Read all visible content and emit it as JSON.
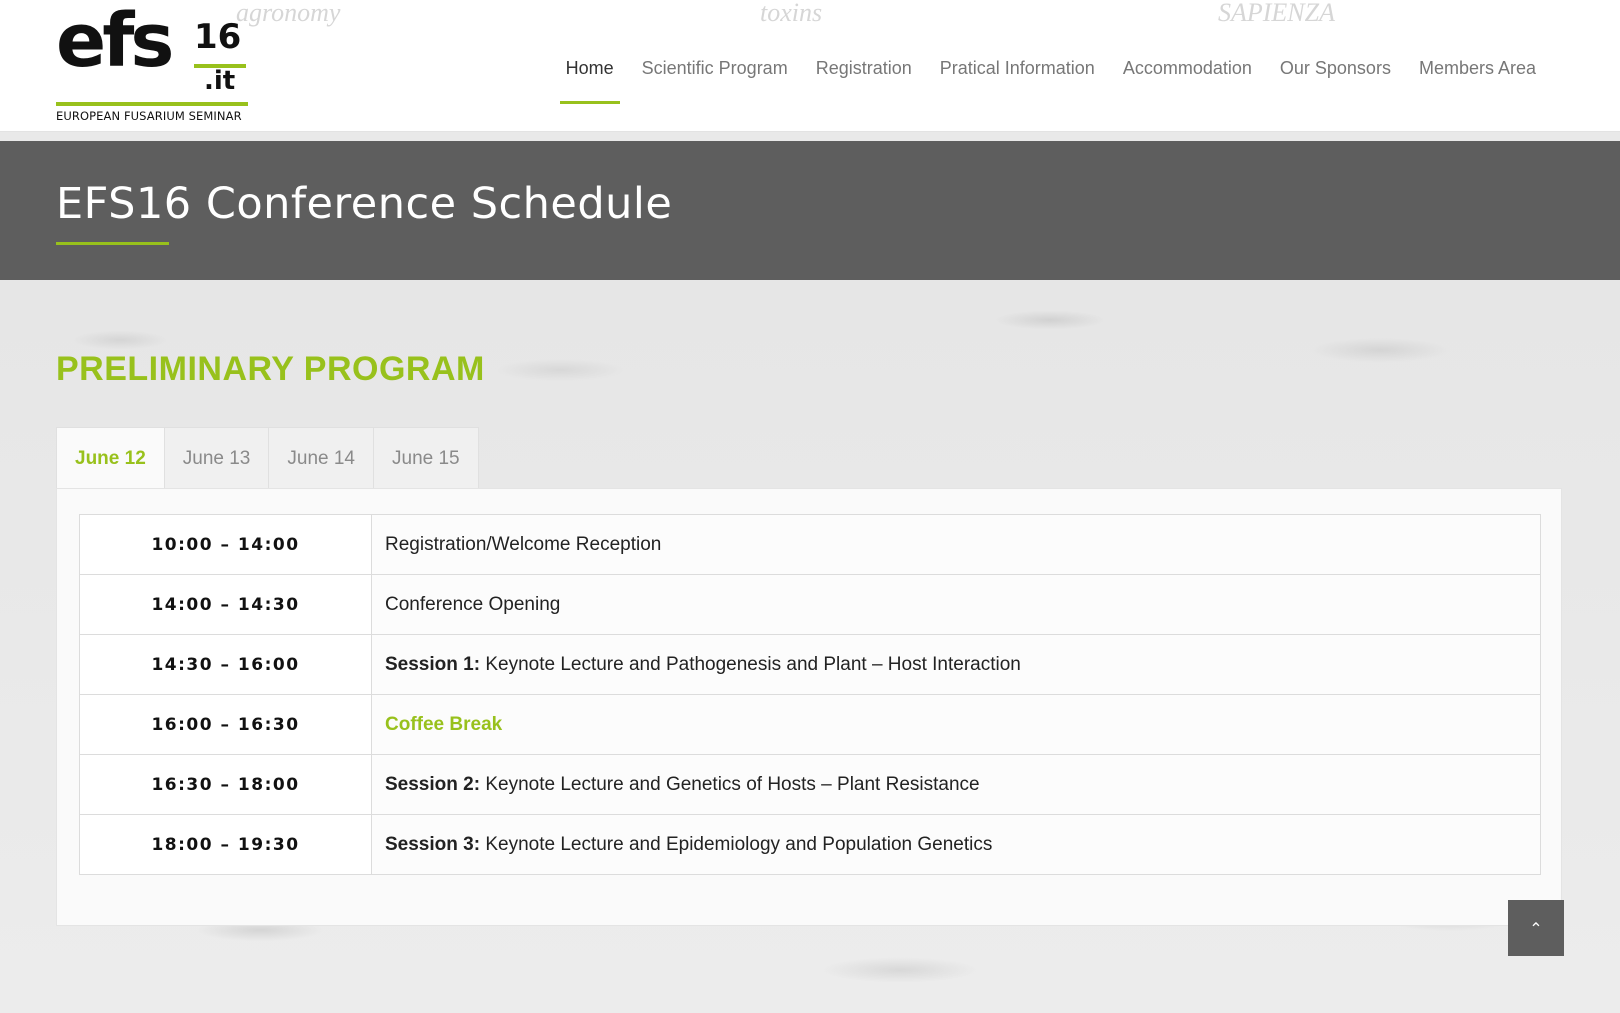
{
  "header": {
    "logo": {
      "mark": "efs",
      "sup": "16",
      "it": ".it",
      "tagline": "EUROPEAN FUSARIUM SEMINAR"
    },
    "sponsor_ghosts": [
      "agronomy",
      "toxins",
      "SAPIENZA"
    ],
    "nav": [
      {
        "label": "Home",
        "active": true
      },
      {
        "label": "Scientific Program"
      },
      {
        "label": "Registration"
      },
      {
        "label": "Pratical Information"
      },
      {
        "label": "Accommodation"
      },
      {
        "label": "Our Sponsors"
      },
      {
        "label": "Members Area"
      }
    ]
  },
  "title_bar": {
    "title": "EFS16 Conference Schedule"
  },
  "program": {
    "heading": "PRELIMINARY PROGRAM",
    "tabs": [
      "June 12",
      "June 13",
      "June 14",
      "June 15"
    ],
    "active_tab": "June 12",
    "rows": [
      {
        "time": "10:00 – 14:00",
        "prefix": "",
        "text": "Registration/Welcome Reception"
      },
      {
        "time": "14:00 – 14:30",
        "prefix": "",
        "text": "Conference Opening"
      },
      {
        "time": "14:30 – 16:00",
        "prefix": "Session 1:",
        "text": " Keynote Lecture and Pathogenesis and Plant – Host Interaction"
      },
      {
        "time": "16:00 – 16:30",
        "prefix": "",
        "highlight": "Coffee Break",
        "text": ""
      },
      {
        "time": "16:30 – 18:00",
        "prefix": "Session 2:",
        "text": " Keynote Lecture and Genetics of Hosts – Plant Resistance"
      },
      {
        "time": "18:00 – 19:30",
        "prefix": "Session 3:",
        "text": " Keynote Lecture and Epidemiology and Population Genetics"
      }
    ]
  },
  "scroll_top": {
    "icon": "chevron-up-icon",
    "glyph": "⌃"
  },
  "colors": {
    "accent": "#98c11c",
    "title_bar": "#5e5e5e",
    "nav_active": "#333333",
    "nav": "#777777"
  }
}
